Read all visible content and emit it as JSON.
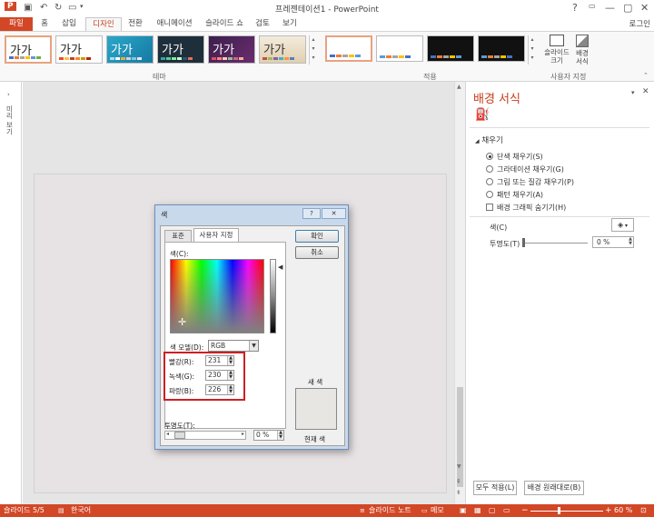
{
  "window": {
    "title": "프레젠테이션1 - PowerPoint",
    "help": "?",
    "minimize": "—",
    "restore": "▢",
    "close": "✕"
  },
  "tabs": [
    {
      "label": "파일"
    },
    {
      "label": "홈"
    },
    {
      "label": "삽입"
    },
    {
      "label": "디자인"
    },
    {
      "label": "전환"
    },
    {
      "label": "애니메이션"
    },
    {
      "label": "슬라이드 쇼"
    },
    {
      "label": "검토"
    },
    {
      "label": "보기"
    }
  ],
  "signin": "로그인",
  "ribbon": {
    "theme_sample": "가가",
    "group_theme": "테마",
    "group_variant": "적용",
    "group_customize": "사용자 지정",
    "slide_size_line1": "슬라이드",
    "slide_size_line2": "크기",
    "format_bg_line1": "배경",
    "format_bg_line2": "서식"
  },
  "left_strip": {
    "label": "미리 보기"
  },
  "pane": {
    "title": "배경 서식",
    "section": "채우기",
    "options": [
      {
        "label": "단색 채우기(S)",
        "selected": true
      },
      {
        "label": "그라데이션 채우기(G)",
        "selected": false
      },
      {
        "label": "그림 또는 질감 채우기(P)",
        "selected": false
      },
      {
        "label": "패턴 채우기(A)",
        "selected": false
      }
    ],
    "hide_graphics": "배경 그래픽 숨기기(H)",
    "color_label": "색(C)",
    "transparency_label": "투명도(T)",
    "transparency_value": "0 %",
    "apply_all": "모두 적용(L)",
    "reset_bg": "배경 원래대로(B)"
  },
  "dialog": {
    "title": "색",
    "help": "?",
    "close": "✕",
    "tab_standard": "표준",
    "tab_custom": "사용자 지정",
    "ok": "확인",
    "cancel": "취소",
    "colors_label": "색(C):",
    "color_model_label": "색 모델(D):",
    "color_model_value": "RGB",
    "red_label": "빨강(R):",
    "red_value": "231",
    "green_label": "녹색(G):",
    "green_value": "230",
    "blue_label": "파랑(B):",
    "blue_value": "226",
    "transparency_label": "투명도(T):",
    "transparency_value": "0 %",
    "new_label": "새 색",
    "current_label": "현재 색",
    "preview_color": "#e7e6e2"
  },
  "status": {
    "slide": "슬라이드 5/5",
    "language": "한국어",
    "notes": "슬라이드 노트",
    "comments": "메모",
    "zoom": "60 %"
  },
  "colors": {
    "accent": "#d24726",
    "highlight_box": "#cc1f26"
  }
}
